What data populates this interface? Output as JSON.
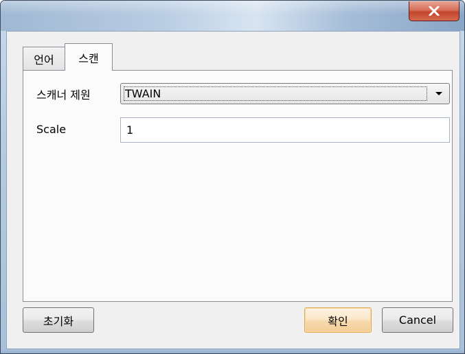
{
  "window": {
    "close_icon": "close-x-icon"
  },
  "tabs": [
    {
      "label": "언어",
      "active": false
    },
    {
      "label": "스캔",
      "active": true
    }
  ],
  "scan": {
    "scanner_source_label": "스캐너 제원",
    "scanner_source_value": "TWAIN",
    "scale_label": "Scale",
    "scale_value": "1"
  },
  "buttons": {
    "reset": "초기화",
    "ok": "확인",
    "cancel": "Cancel"
  },
  "colors": {
    "close_button": "#c7432b",
    "default_button_border": "#e2a64c"
  }
}
